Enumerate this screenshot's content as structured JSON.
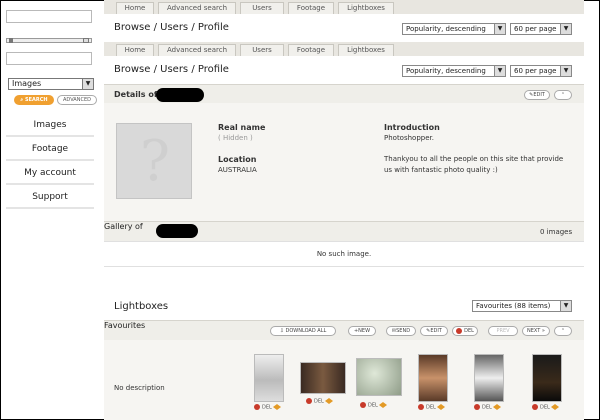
{
  "sidebar": {
    "type_select": "Images",
    "search_label": "SEARCH",
    "advanced_label": "ADVANCED",
    "nav": [
      "Images",
      "Footage",
      "My account",
      "Support"
    ]
  },
  "tabs": [
    "Home",
    "Advanced search",
    "Users",
    "Footage",
    "Lightboxes"
  ],
  "breadcrumb": "Browse / Users / Profile",
  "sort_select": "Popularity, descending",
  "perpage_select": "60 per page",
  "details": {
    "title": "Details of",
    "edit_label": "EDIT",
    "real_name_label": "Real name",
    "real_name_value": "( Hidden )",
    "location_label": "Location",
    "location_value": "AUSTRALIA",
    "intro_label": "Introduction",
    "intro_line1": "Photoshopper.",
    "intro_line2": "Thankyou to all the people on this site that provide",
    "intro_line3": "us with fantastic photo quality :)"
  },
  "gallery": {
    "title": "Gallery of",
    "count": "0 images",
    "empty_message": "No such image."
  },
  "lightboxes": {
    "title": "Lightboxes",
    "select": "Favourites (88 items)",
    "panel_title": "Favourites",
    "download_all": "DOWNLOAD ALL",
    "new_label": "NEW",
    "send_label": "SEND",
    "edit_label": "EDIT",
    "del_label": "DEL",
    "prev_label": "PREV",
    "next_label": "NEXT",
    "no_description": "No description",
    "thumb_del": "DEL"
  },
  "colors": {
    "accent": "#f0a030",
    "danger": "#c83a2a"
  }
}
